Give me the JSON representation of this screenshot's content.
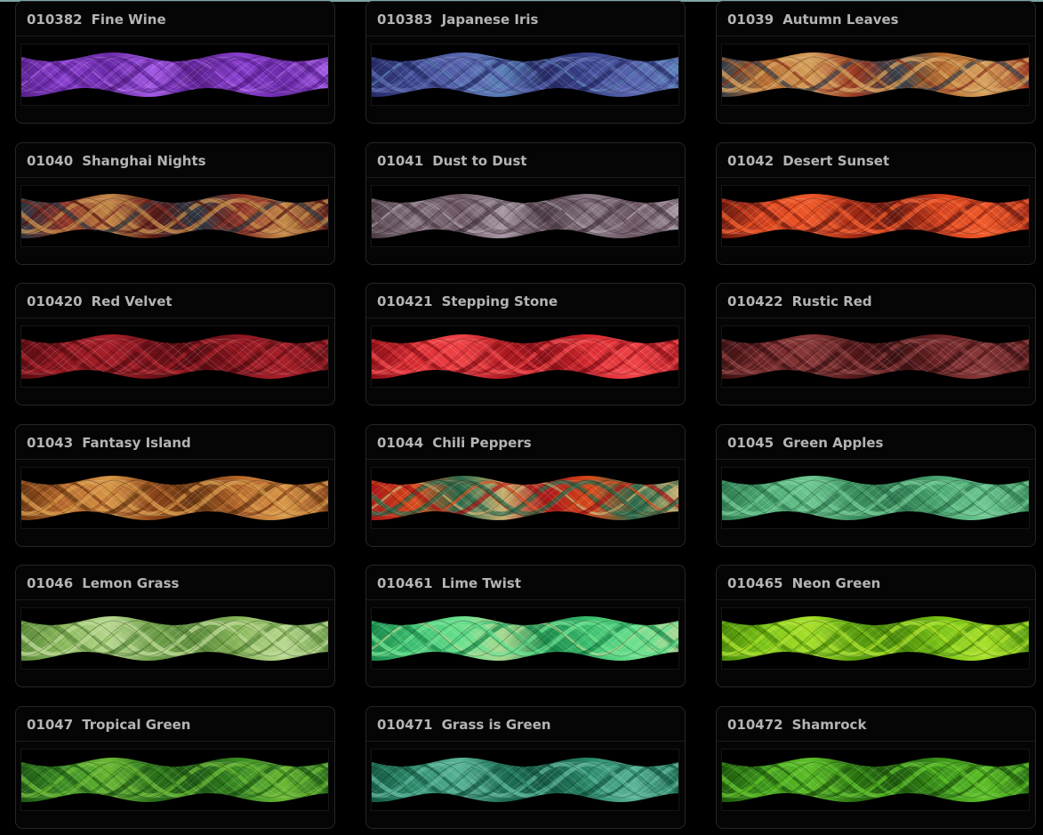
{
  "threads": [
    {
      "code": "010382",
      "name": "Fine Wine",
      "colors": [
        "#5a1f8c",
        "#8a3fd0",
        "#6a2aa8",
        "#a55ae6"
      ]
    },
    {
      "code": "010383",
      "name": "Japanese Iris",
      "colors": [
        "#262a66",
        "#3c468f",
        "#5967b0",
        "#5a7fb8"
      ]
    },
    {
      "code": "01039",
      "name": "Autumn Leaves",
      "colors": [
        "#3a3e48",
        "#b56a2c",
        "#d7a25e",
        "#9a3a22"
      ]
    },
    {
      "code": "01040",
      "name": "Shanghai Nights",
      "colors": [
        "#2e3540",
        "#8c3024",
        "#c48a48",
        "#5a1a16"
      ]
    },
    {
      "code": "01041",
      "name": "Dust to Dust",
      "colors": [
        "#4a3a44",
        "#8a7a86",
        "#6b5562",
        "#a89aa6"
      ]
    },
    {
      "code": "01042",
      "name": "Desert Sunset",
      "colors": [
        "#6a1a10",
        "#d4401c",
        "#f05a2a",
        "#a22a14"
      ]
    },
    {
      "code": "010420",
      "name": "Red Velvet",
      "colors": [
        "#5a0c12",
        "#8e1620",
        "#a8202a",
        "#6e1018"
      ]
    },
    {
      "code": "010421",
      "name": "Stepping Stone",
      "colors": [
        "#8e1018",
        "#d82a30",
        "#f04448",
        "#b01a22"
      ]
    },
    {
      "code": "010422",
      "name": "Rustic Red",
      "colors": [
        "#3e1214",
        "#6e2426",
        "#8a3a3a",
        "#54181a"
      ]
    },
    {
      "code": "01043",
      "name": "Fantasy Island",
      "colors": [
        "#6a3812",
        "#b8682a",
        "#d89848",
        "#8a4418"
      ]
    },
    {
      "code": "01044",
      "name": "Chili Peppers",
      "colors": [
        "#a81818",
        "#d84a1a",
        "#2a6a4a",
        "#c8b070"
      ]
    },
    {
      "code": "01045",
      "name": "Green Apples",
      "colors": [
        "#2e7a50",
        "#4aa872",
        "#6ec892",
        "#3a8e5e"
      ]
    },
    {
      "code": "01046",
      "name": "Lemon Grass",
      "colors": [
        "#5a8a3a",
        "#8ab85a",
        "#b8d890",
        "#6e9e4a"
      ]
    },
    {
      "code": "010461",
      "name": "Lime Twist",
      "colors": [
        "#1a8a4a",
        "#3cc070",
        "#6ae08e",
        "#a8d890"
      ]
    },
    {
      "code": "010465",
      "name": "Neon Green",
      "colors": [
        "#4a8a08",
        "#7ac414",
        "#a8e02a",
        "#5a9e0e"
      ]
    },
    {
      "code": "01047",
      "name": "Tropical Green",
      "colors": [
        "#1e5a14",
        "#3a8e22",
        "#6ab834",
        "#2a7018"
      ]
    },
    {
      "code": "010471",
      "name": "Grass is Green",
      "colors": [
        "#145a44",
        "#2a8a6a",
        "#5ab49a",
        "#1e6e56"
      ]
    },
    {
      "code": "010472",
      "name": "Shamrock",
      "colors": [
        "#1e5a0c",
        "#3a9618",
        "#5ec028",
        "#2a7410"
      ]
    }
  ]
}
